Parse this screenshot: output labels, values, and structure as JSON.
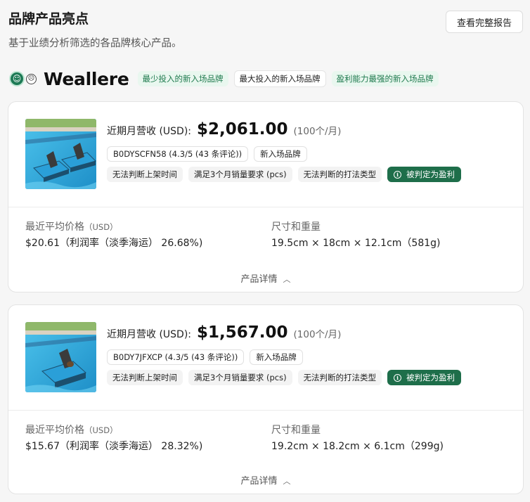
{
  "header": {
    "title": "品牌产品亮点",
    "subtitle": "基于业绩分析筛选的各品牌核心产品。",
    "report_button": "查看完整报告"
  },
  "brand": {
    "name": "Weallere",
    "icons": [
      "smile-icon",
      "neutral-face-icon"
    ],
    "tags": [
      {
        "label": "最少投入的新入场品牌",
        "style": "green"
      },
      {
        "label": "最大投入的新入场品牌",
        "style": "white"
      },
      {
        "label": "盈利能力最强的新入场品牌",
        "style": "green"
      }
    ]
  },
  "products": [
    {
      "revenue_label": "近期月营收 (USD):",
      "revenue_value": "$2,061.00",
      "revenue_unit": "(100个/月)",
      "asin_info": "B0DYSCFN58 (4.3/5 (43 条评论))",
      "brand_tag": "新入场品牌",
      "tags": [
        "无法判断上架时间",
        "满足3个月销量要求 (pcs)",
        "无法判断的打法类型"
      ],
      "profit_tag": "被判定为盈利",
      "avg_price_label": "最近平均价格",
      "avg_price_unit": "（USD）",
      "avg_price_value": "$20.61（利润率（淡季海运） 26.68%)",
      "size_label": "尺寸和重量",
      "size_value": "19.5cm × 18cm × 12.1cm（581g)",
      "details_label": "产品详情"
    },
    {
      "revenue_label": "近期月营收 (USD):",
      "revenue_value": "$1,567.00",
      "revenue_unit": "(100个/月)",
      "asin_info": "B0DY7JFXCP (4.3/5 (43 条评论))",
      "brand_tag": "新入场品牌",
      "tags": [
        "无法判断上架时间",
        "满足3个月销量要求 (pcs)",
        "无法判断的打法类型"
      ],
      "profit_tag": "被判定为盈利",
      "avg_price_label": "最近平均价格",
      "avg_price_unit": "（USD）",
      "avg_price_value": "$15.67（利润率（淡季海运） 28.32%)",
      "size_label": "尺寸和重量",
      "size_value": "19.2cm × 18.2cm × 6.1cm（299g)",
      "details_label": "产品详情"
    }
  ],
  "colors": {
    "accent_green": "#1e6e4a",
    "tag_green_bg": "#e9f7ef",
    "tag_green_text": "#1f7a4e"
  }
}
